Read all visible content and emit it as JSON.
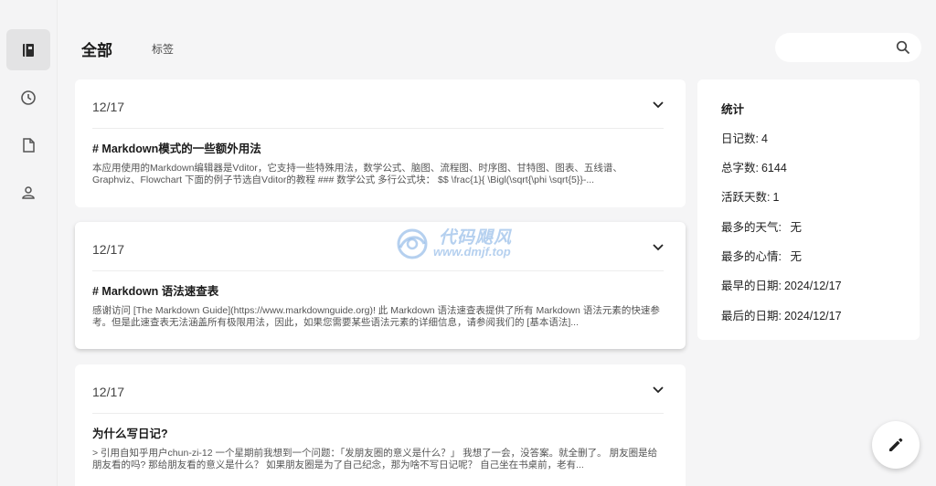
{
  "window": {
    "controls": [
      "minimize",
      "maximize",
      "close"
    ]
  },
  "rail": {
    "items": [
      {
        "icon": "notebook-icon",
        "active": true
      },
      {
        "icon": "clock-icon",
        "active": false
      },
      {
        "icon": "document-icon",
        "active": false
      },
      {
        "icon": "person-icon",
        "active": false
      }
    ]
  },
  "header": {
    "tab_all": "全部",
    "tab_tags": "标签"
  },
  "search": {
    "value": "",
    "placeholder": ""
  },
  "entries": [
    {
      "date": "12/17",
      "title": "# Markdown模式的一些额外用法",
      "excerpt": "本应用使用的Markdown编辑器是Vditor，它支持一些特殊用法，数学公式、脑图、流程图、时序图、甘特图、图表、五线谱、Graphviz、Flowchart 下面的例子节选自Vditor的教程 ### 数学公式 多行公式块： $$ \\frac{1}{ \\Bigl(\\sqrt{\\phi \\sqrt{5}}-..."
    },
    {
      "date": "12/17",
      "title": "# Markdown 语法速查表",
      "excerpt": "感谢访问 [The Markdown Guide](https://www.markdownguide.org)! 此 Markdown 语法速查表提供了所有 Markdown 语法元素的快速参考。但是此速查表无法涵盖所有极限用法，因此，如果您需要某些语法元素的详细信息，请参阅我们的 [基本语法]..."
    },
    {
      "date": "12/17",
      "title": "为什么写日记?",
      "excerpt": "> 引用自知乎用户chun-zi-12 一个星期前我想到一个问题：「发朋友圈的意义是什么？」 我想了一会，没答案。就全删了。 朋友圈是给朋友看的吗? 那给朋友看的意义是什么？ 如果朋友圈是为了自己纪念，那为啥不写日记呢？ 自己坐在书桌前，老有..."
    }
  ],
  "stats": {
    "title": "统计",
    "rows": [
      {
        "label": "日记数:",
        "value": "4"
      },
      {
        "label": "总字数:",
        "value": "6144"
      },
      {
        "label": "活跃天数:",
        "value": "1"
      },
      {
        "label": "最多的天气:",
        "value": " 无"
      },
      {
        "label": "最多的心情:",
        "value": " 无"
      },
      {
        "label": "最早的日期:",
        "value": "2024/12/17"
      },
      {
        "label": "最后的日期:",
        "value": "2024/12/17"
      }
    ]
  },
  "watermark": {
    "line1": "代码飓风",
    "line2": "www.dmjf.top"
  },
  "fab": {
    "icon": "pencil-icon"
  },
  "colors": {
    "background": "#f5f5f6",
    "card": "#ffffff",
    "rail_active": "#e3e3e4",
    "text": "#1f1f1f",
    "watermark": "#78aae1"
  }
}
